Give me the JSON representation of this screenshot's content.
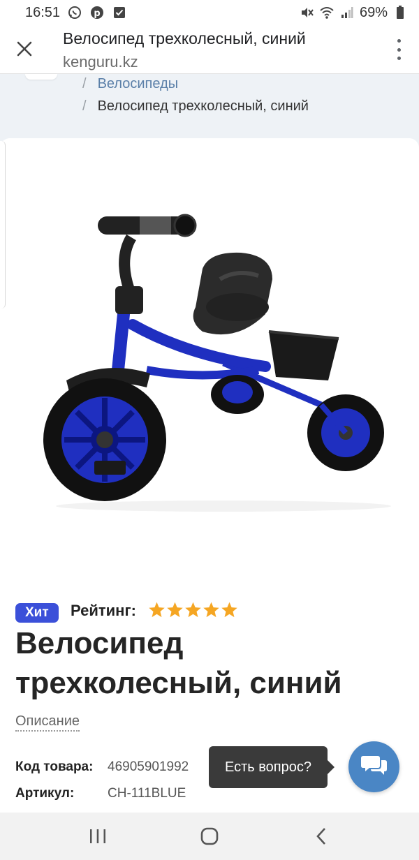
{
  "status_bar": {
    "time": "16:51",
    "battery": "69%",
    "left_icons": [
      "whatsapp-icon",
      "pinterest-icon",
      "checkbox-notification-icon"
    ],
    "right_icons": [
      "mute-icon",
      "wifi-icon",
      "signal-icon",
      "battery-icon"
    ]
  },
  "custom_tab": {
    "title": "Велосипед трехколесный, синий",
    "domain": "kenguru.kz"
  },
  "breadcrumb": {
    "separator": "/",
    "items": [
      {
        "label": "Велосипеды"
      },
      {
        "label": "Велосипед трехколесный, синий"
      }
    ]
  },
  "product": {
    "badge": "Хит",
    "rating_label": "Рейтинг:",
    "rating": 5,
    "rating_max": 5,
    "title": "Велосипед трехколесный, синий",
    "description_link": "Описание",
    "specs": [
      {
        "key": "Код товара:",
        "value": "46905901992"
      },
      {
        "key": "Артикул:",
        "value": "CH-111BLUE"
      }
    ]
  },
  "chat": {
    "tooltip": "Есть вопрос?"
  },
  "colors": {
    "accent_badge": "#3b50d9",
    "star": "#f5a623",
    "chat_button": "#4a86c5",
    "frame_blue": "#1f2fc0",
    "page_background": "#eef2f6"
  }
}
